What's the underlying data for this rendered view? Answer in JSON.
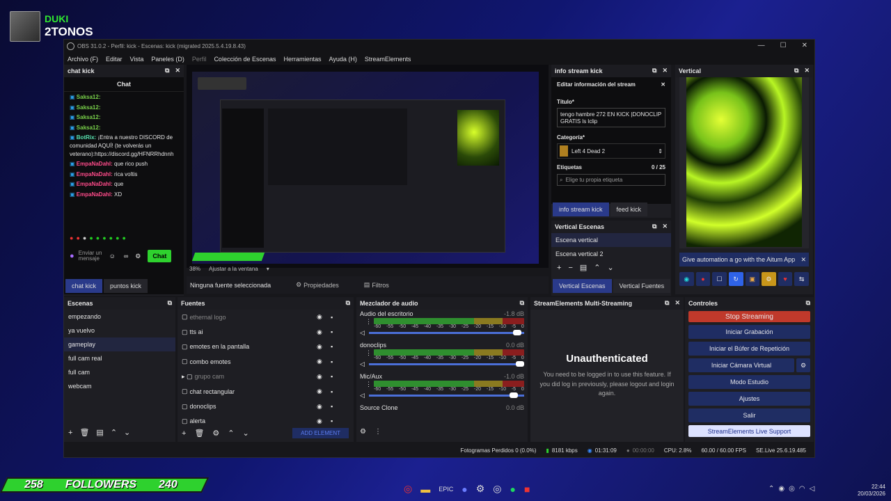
{
  "overlay": {
    "name1": "DUKI",
    "name2": "2TONOS"
  },
  "window": {
    "title": "OBS 31.0.2 - Perfil: kick - Escenas: kick (migrated 2025.5.4.19.8.43)"
  },
  "menu": [
    "Archivo (F)",
    "Editar",
    "Vista",
    "Paneles (D)",
    "Perfil",
    "Colección de Escenas",
    "Herramientas",
    "Ayuda (H)",
    "StreamElements"
  ],
  "chat": {
    "title": "chat kick",
    "header": "Chat",
    "placeholder": "Enviar un mensaje",
    "send": "Chat",
    "messages": [
      {
        "user": "Saksa12:",
        "text": "",
        "ucolor": "#7ad34a"
      },
      {
        "user": "Saksa12:",
        "text": "",
        "ucolor": "#7ad34a"
      },
      {
        "user": "Saksa12:",
        "text": "",
        "ucolor": "#7ad34a"
      },
      {
        "user": "Saksa12:",
        "text": "",
        "ucolor": "#7ad34a"
      },
      {
        "user": "BotRix:",
        "text": "¡Entra a nuestro DISCORD de comunidad AQUÍ! (te volverás un veterano):https://discord.gg/HFNRRhdnnh",
        "ucolor": "#59e3b0"
      },
      {
        "user": "EmpaNaDahl:",
        "text": "que rico push",
        "ucolor": "#ff4b8a"
      },
      {
        "user": "EmpaNaDahl:",
        "text": "rica voltis",
        "ucolor": "#ff4b8a"
      },
      {
        "user": "EmpaNaDahl:",
        "text": "que",
        "ucolor": "#ff4b8a"
      },
      {
        "user": "EmpaNaDahl:",
        "text": "XD",
        "ucolor": "#ff4b8a"
      }
    ],
    "tabs": [
      "chat kick",
      "puntos kick"
    ]
  },
  "preview": {
    "zoom": "38%",
    "fit": "Ajustar a la ventana"
  },
  "sourcebar": {
    "none": "Ninguna fuente seleccionada",
    "props": "Propiedades",
    "filters": "Filtros"
  },
  "info": {
    "title": "info stream kick",
    "edit": "Editar información del stream",
    "title_label": "Título*",
    "title_val": "tengo hambre 272 EN KICK |DONOCLIP GRATIS ls lclip",
    "cat_label": "Categoría*",
    "cat_val": "Left 4 Dead 2",
    "tags_label": "Etiquetas",
    "tags_count": "0 / 25",
    "tags_ph": "Elige tu propia etiqueta",
    "tabs": [
      "info stream kick",
      "feed kick"
    ]
  },
  "vscenes": {
    "title": "Vertical Escenas",
    "items": [
      "Escena vertical",
      "Escena vertical 2"
    ],
    "tabs": [
      "Vertical Escenas",
      "Vertical Fuentes"
    ]
  },
  "vertical": {
    "title": "Vertical",
    "promo": "Give automation a go with the Aitum App"
  },
  "scenes": {
    "title": "Escenas",
    "items": [
      "empezando",
      "ya vuelvo",
      "gameplay",
      "full cam real",
      "full cam",
      "webcam"
    ],
    "selected": 2
  },
  "sources": {
    "title": "Fuentes",
    "items": [
      "ethernal logo",
      "tts ai",
      "emotes en la pantalla",
      "combo emotes",
      "grupo cam",
      "chat rectangular",
      "donoclips",
      "alerta"
    ],
    "add": "ADD ELEMENT"
  },
  "mixer": {
    "title": "Mezclador de audio",
    "channels": [
      {
        "name": "Audio del escritorio",
        "db": "-1.8 dB",
        "level": 0.98
      },
      {
        "name": "donoclips",
        "db": "0.0 dB",
        "level": 1.0
      },
      {
        "name": "Mic/Aux",
        "db": "-1.0 dB",
        "level": 0.96
      },
      {
        "name": "Source Clone",
        "db": "0.0 dB",
        "level": 1.0
      }
    ],
    "ticks": [
      "-60",
      "-55",
      "-50",
      "-45",
      "-40",
      "-35",
      "-30",
      "-25",
      "-20",
      "-15",
      "-10",
      "-5",
      "0"
    ]
  },
  "multi": {
    "title": "StreamElements Multi-Streaming",
    "heading": "Unauthenticated",
    "body": "You need to be logged in to use this feature. If you did log in previously, please logout and login again."
  },
  "controls": {
    "title": "Controles",
    "stop": "Stop Streaming",
    "buttons": [
      "Iniciar Grabación",
      "Iniciar el Búfer de Repetición",
      "Iniciar Cámara Virtual",
      "Modo Estudio",
      "Ajustes",
      "Salir"
    ],
    "support": "StreamElements Live Support"
  },
  "status": {
    "frames": "Fotogramas Perdidos 0 (0.0%)",
    "kbps": "8181 kbps",
    "live": "01:31:09",
    "rec": "00:00:00",
    "cpu": "CPU: 2.8%",
    "fps": "60.00 / 60.00 FPS",
    "se": "SE.Live 25.6.19.485"
  },
  "followers": {
    "left": "258",
    "label": "FOLLOWERS",
    "right": "240"
  },
  "clock": {
    "time": "22:44",
    "date": "20/03/2026"
  },
  "colors": {
    "accent": "#1f2d63",
    "live": "#c0392b",
    "green": "#2ed12e"
  }
}
